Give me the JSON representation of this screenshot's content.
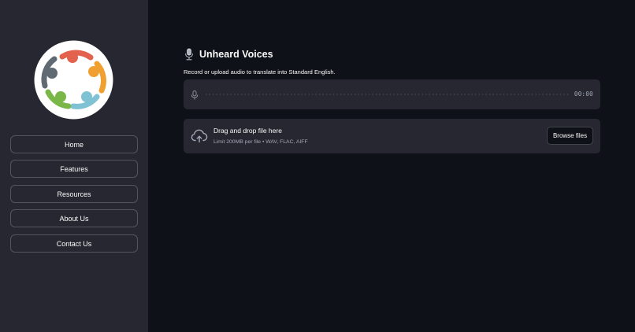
{
  "sidebar": {
    "logo_icon": "people-circle-logo",
    "nav": [
      {
        "label": "Home"
      },
      {
        "label": "Features"
      },
      {
        "label": "Resources"
      },
      {
        "label": "About Us"
      },
      {
        "label": "Contact Us"
      }
    ]
  },
  "main": {
    "title_icon": "studio-microphone-emoji",
    "title": "Unheard Voices",
    "subtitle": "Record or upload audio to translate into Standard English.",
    "recorder": {
      "mic_icon": "microphone-icon",
      "time": "00:00"
    },
    "uploader": {
      "icon": "cloud-upload-icon",
      "drag_text": "Drag and drop file here",
      "limit_text": "Limit 200MB per file • WAV, FLAC, AIFF",
      "browse_label": "Browse files"
    }
  },
  "colors": {
    "sidebar_bg": "#262730",
    "main_bg": "#0e1117",
    "widget_bg": "#262730",
    "logo_red": "#e2624d",
    "logo_orange": "#f0a030",
    "logo_blue": "#7fc2d4",
    "logo_green": "#7ab648",
    "logo_gray": "#5f6a73"
  }
}
